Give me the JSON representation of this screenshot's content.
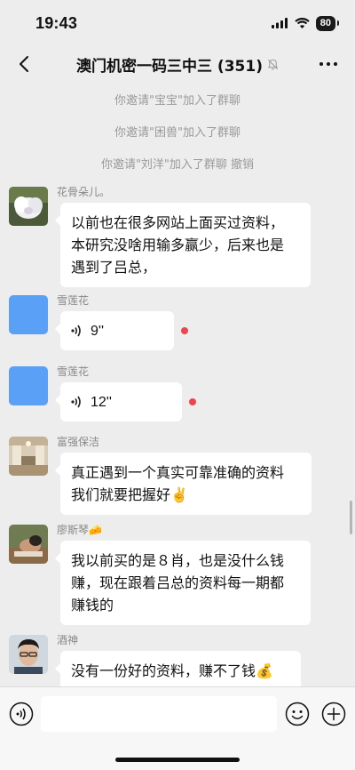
{
  "status": {
    "time": "19:43",
    "battery": "80"
  },
  "nav": {
    "title": "澳门机密一码三中三 (351)"
  },
  "system_messages": [
    {
      "text": "你邀请\"宝宝\"加入了群聊",
      "action": ""
    },
    {
      "text": "你邀请\"困兽\"加入了群聊",
      "action": ""
    },
    {
      "text": "你邀请\"刘洋\"加入了群聊",
      "action": "撤销"
    }
  ],
  "messages": [
    {
      "sender": "花骨朵儿。",
      "type": "text",
      "lines": [
        "以前也在很多网站上面买过资料，",
        "本研究没啥用输多赢少，后来也是",
        "遇到了吕总，"
      ]
    },
    {
      "sender": "雪莲花",
      "type": "voice",
      "duration": "9''",
      "unread": true
    },
    {
      "sender": "雪莲花",
      "type": "voice",
      "duration": "12''",
      "unread": true
    },
    {
      "sender": "富强保洁",
      "type": "text",
      "lines": [
        "真正遇到一个真实可靠准确的资料",
        "我们就要把握好✌️"
      ]
    },
    {
      "sender": "廖斯琴🧀",
      "type": "text",
      "lines": [
        "我以前买的是８肖，也是没什么钱",
        "赚，现在跟着吕总的资料每一期都",
        "赚钱的"
      ]
    },
    {
      "sender": "酒神",
      "type": "text",
      "lines": [
        "没有一份好的资料，赚不了钱💰"
      ]
    }
  ],
  "input": {
    "value": "",
    "placeholder": ""
  },
  "colors": {
    "background": "#ededed",
    "bubble": "#ffffff",
    "unread": "#f0434e",
    "placeholder_avatar": "#5aa0f7"
  }
}
